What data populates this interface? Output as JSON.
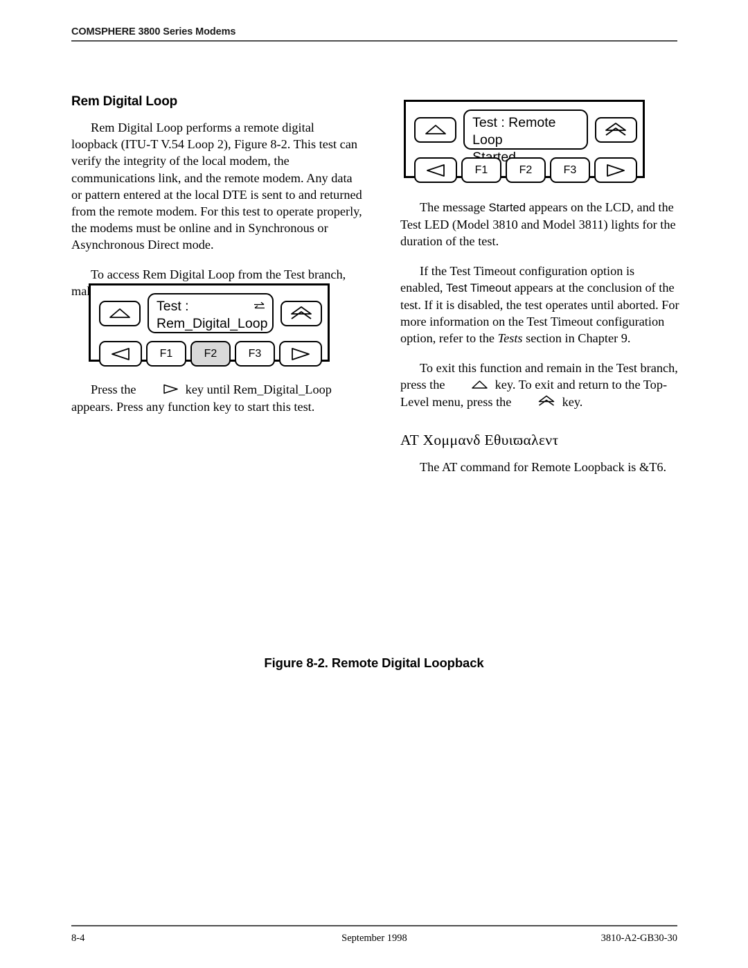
{
  "header": {
    "title": "COMSPHERE 3800 Series Modems"
  },
  "left_column": {
    "section_title": "Rem Digital Loop",
    "paragraph_1": "Rem Digital Loop performs a remote digital loopback (ITU-T V.54 Loop 2), Figure 8-2. This test can verify the integrity of the local modem, the communications link, and the remote modem. Any data or pattern entered at the local DTE is sent to and returned from the remote modem. For this test to operate properly, the modems must be online and in Synchronous or Asynchronous Direct mode.",
    "paragraph_2": "To access Rem Digital Loop from the Test branch, make the following selections:",
    "paragraph_3_part1": "Press the",
    "paragraph_3_key": "right-arrow-key",
    "paragraph_3_part2": "key until Rem_Digital_Loop appears. Press any function key to start this test."
  },
  "right_column": {
    "paragraph_1_pre": "The message",
    "paragraph_1_mono": "Started",
    "paragraph_1_post": "appears on the LCD, and the Test LED (Model 3810 and Model 3811) lights for the duration of the test.",
    "paragraph_2_pre": "If the Test Timeout configuration option is enabled,",
    "paragraph_2_mono": "Test Timeout",
    "paragraph_2_mid": "appears at the conclusion of the test. If it is disabled, the test operates until aborted. For more information on the Test Timeout configuration option, refer to the",
    "paragraph_2_italic": "Tests",
    "paragraph_2_post": "section in Chapter 9.",
    "paragraph_3_pre": "To exit this function and remain in the Test branch, press the",
    "paragraph_3_key1": "up-arrow-key",
    "paragraph_3_mid": "key. To exit and return to the Top-Level menu, press the",
    "paragraph_3_key2": "top-level-key",
    "paragraph_3_post": "key.",
    "at_heading": "ΑΤ Χομμανδ Εθυιϖαλεντ",
    "at_paragraph": "The AT command for Remote Loopback is &T6."
  },
  "panel_left": {
    "name": "test-rem-digital-loop-panel",
    "lcd_line_1": "Test :",
    "lcd_line_2": "Rem_Digital_Loop",
    "lcd_icon": "data-exchange-icon",
    "up_key": "up-arrow-key",
    "top_level_key": "top-level-key",
    "left_key": "left-arrow-key",
    "right_key": "right-arrow-key",
    "function_keys": [
      {
        "label": "F1",
        "active": false
      },
      {
        "label": "F2",
        "active": true
      },
      {
        "label": "F3",
        "active": false
      }
    ]
  },
  "panel_right": {
    "name": "test-remote-loop-started-panel",
    "lcd_line_1": "Test : Remote Loop",
    "lcd_line_2": "Started",
    "up_key": "up-arrow-key",
    "top_level_key": "top-level-key",
    "left_key": "left-arrow-key",
    "right_key": "right-arrow-key",
    "function_keys": [
      {
        "label": "F1",
        "active": false
      },
      {
        "label": "F2",
        "active": false
      },
      {
        "label": "F3",
        "active": false
      }
    ]
  },
  "figure": {
    "caption": "Figure 8-2.  Remote Digital Loopback"
  },
  "footer": {
    "page_number": "8-4",
    "date": "September 1998",
    "document_number": "3810-A2-GB30-30"
  },
  "colors": {
    "active_key_fill": "#d9d9d9",
    "rule": "#4d4d4d",
    "ink": "#000000"
  }
}
